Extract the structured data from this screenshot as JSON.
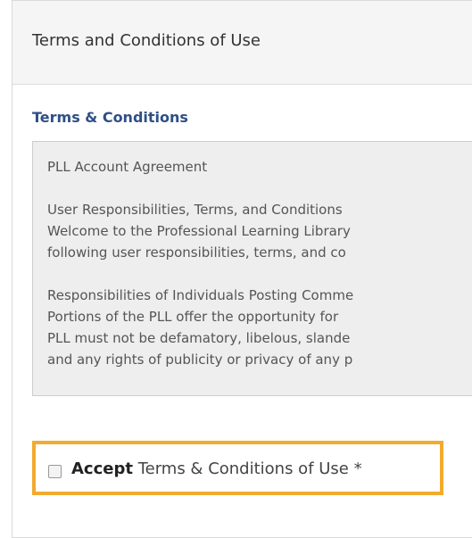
{
  "panel": {
    "title": "Terms and Conditions of Use"
  },
  "terms": {
    "section_label": "Terms & Conditions",
    "paragraphs": [
      {
        "lines": [
          "PLL Account Agreement"
        ]
      },
      {
        "lines": [
          "User Responsibilities, Terms, and Conditions",
          "Welcome to the Professional Learning Library",
          "following user responsibilities, terms, and co"
        ]
      },
      {
        "lines": [
          "Responsibilities of Individuals Posting Comme",
          "Portions of the PLL offer the opportunity for",
          "PLL must not be defamatory, libelous, slande",
          "and any rights of publicity or privacy of any p"
        ]
      }
    ]
  },
  "accept": {
    "strong_label": "Accept",
    "rest_label": "Terms & Conditions of Use *",
    "checked": false,
    "highlight_color": "#f2ab2f"
  }
}
